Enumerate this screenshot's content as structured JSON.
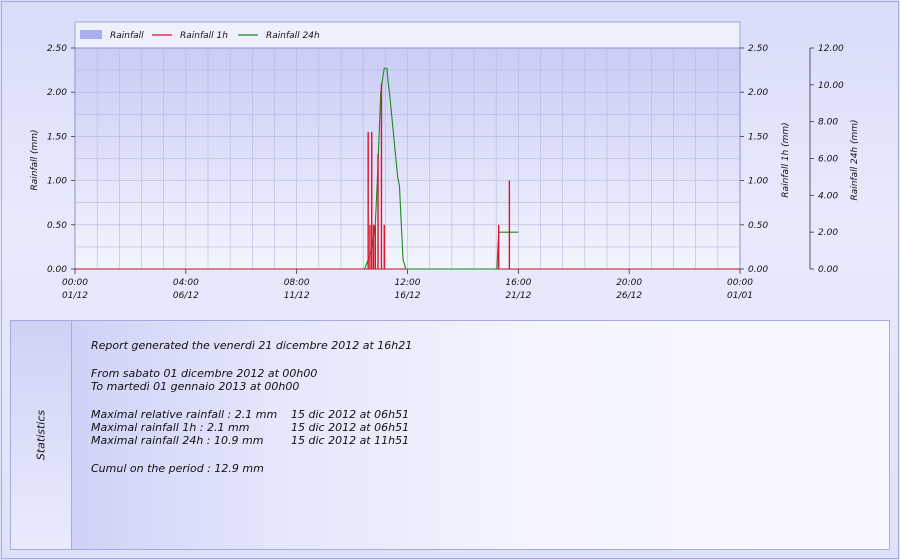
{
  "chart_data": {
    "type": "line",
    "legend": {
      "placement": "top-left",
      "entries": [
        {
          "name": "Rainfall",
          "kind": "area",
          "color": "#a9aef0"
        },
        {
          "name": "Rainfall 1h",
          "kind": "line",
          "color": "#e0102a"
        },
        {
          "name": "Rainfall 24h",
          "kind": "line",
          "color": "#1a8a1a"
        }
      ]
    },
    "x_ticks": [
      {
        "time": "00:00",
        "date": "01/12"
      },
      {
        "time": "04:00",
        "date": "06/12"
      },
      {
        "time": "08:00",
        "date": "11/12"
      },
      {
        "time": "12:00",
        "date": "16/12"
      },
      {
        "time": "16:00",
        "date": "21/12"
      },
      {
        "time": "20:00",
        "date": "26/12"
      },
      {
        "time": "00:00",
        "date": "01/01"
      }
    ],
    "xlim": [
      "2012-12-01 00:00",
      "2013-01-01 00:00"
    ],
    "y_left": {
      "label": "Rainfall (mm)",
      "ylim": [
        0,
        2.5
      ],
      "ticks": [
        "0.00",
        "0.50",
        "1.00",
        "1.50",
        "2.00",
        "2.50"
      ]
    },
    "y_right1": {
      "label": "Rainfall 1h (mm)",
      "ylim": [
        0,
        2.5
      ],
      "ticks": [
        "0.00",
        "0.50",
        "1.00",
        "1.50",
        "2.00",
        "2.50"
      ]
    },
    "y_right2": {
      "label": "Rainfall 24h (mm)",
      "ylim": [
        0,
        12
      ],
      "ticks": [
        "0.00",
        "2.00",
        "4.00",
        "6.00",
        "8.00",
        "10.00",
        "12.00"
      ]
    },
    "grid": true,
    "series": [
      {
        "name": "Rainfall 1h",
        "axis": "right1",
        "bars": [
          {
            "t": "2012-12-14 16:00",
            "v": 1.55
          },
          {
            "t": "2012-12-14 18:00",
            "v": 0.5
          },
          {
            "t": "2012-12-14 20:00",
            "v": 1.55
          },
          {
            "t": "2012-12-14 22:00",
            "v": 0.5
          },
          {
            "t": "2012-12-15 00:00",
            "v": 0.5
          },
          {
            "t": "2012-12-15 03:00",
            "v": 1.3
          },
          {
            "t": "2012-12-15 06:51",
            "v": 2.1
          },
          {
            "t": "2012-12-15 10:00",
            "v": 0.5
          },
          {
            "t": "2012-12-20 18:00",
            "v": 0.5
          },
          {
            "t": "2012-12-21 06:00",
            "v": 1.0
          }
        ]
      },
      {
        "name": "Rainfall 24h",
        "axis": "right2",
        "points": [
          [
            "2012-12-14 12:00",
            0.0
          ],
          [
            "2012-12-14 20:00",
            1.0
          ],
          [
            "2012-12-15 00:00",
            2.5
          ],
          [
            "2012-12-15 02:00",
            4.5
          ],
          [
            "2012-12-15 04:00",
            7.0
          ],
          [
            "2012-12-15 06:00",
            9.5
          ],
          [
            "2012-12-15 08:00",
            10.3
          ],
          [
            "2012-12-15 10:00",
            10.9
          ],
          [
            "2012-12-15 13:00",
            10.9
          ],
          [
            "2012-12-15 14:00",
            10.3
          ],
          [
            "2012-12-15 16:00",
            9.5
          ],
          [
            "2012-12-15 19:00",
            8.0
          ],
          [
            "2012-12-15 22:00",
            6.5
          ],
          [
            "2012-12-16 01:00",
            5.0
          ],
          [
            "2012-12-16 03:00",
            4.5
          ],
          [
            "2012-12-16 05:00",
            2.5
          ],
          [
            "2012-12-16 07:00",
            0.5
          ],
          [
            "2012-12-16 09:00",
            0.2
          ],
          [
            "2012-12-16 10:00",
            0.0
          ],
          [
            "2012-12-20 16:00",
            0.0
          ],
          [
            "2012-12-20 18:00",
            2.0
          ],
          [
            "2012-12-21 07:00",
            2.0
          ],
          [
            "2012-12-21 10:00",
            2.0
          ],
          [
            "2012-12-21 16:00",
            2.0
          ]
        ]
      }
    ]
  },
  "statistics": {
    "title": "Statistics",
    "report_line": "Report generated the venerdì 21 dicembre 2012 at 16h21",
    "from_line": "From sabato 01 dicembre 2012 at 00h00",
    "to_line": "To martedì 01 gennaio 2013 at 00h00",
    "rows": [
      {
        "label": "Maximal relative rainfall : 2.1 mm",
        "date": "15 dic 2012 at 06h51"
      },
      {
        "label": "Maximal rainfall 1h  : 2.1 mm",
        "date": "15 dic 2012 at 06h51"
      },
      {
        "label": "Maximal rainfall 24h : 10.9 mm",
        "date": "15 dic 2012 at 11h51"
      }
    ],
    "cumul_line": "Cumul on the period : 12.9 mm"
  }
}
